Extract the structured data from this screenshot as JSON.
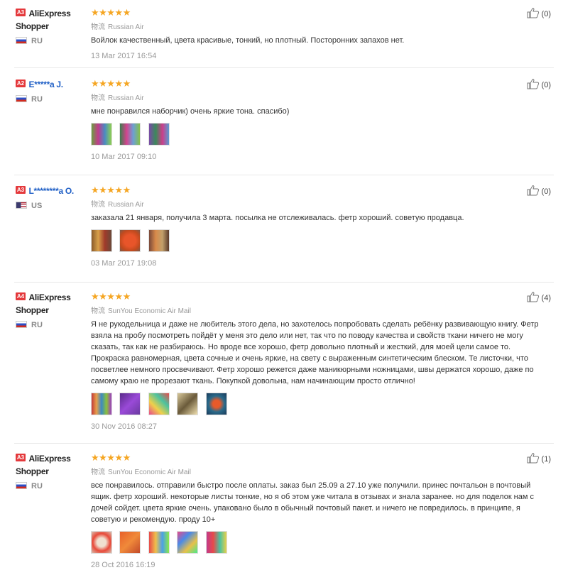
{
  "like_icon": "thumbs-up-icon",
  "reviews": [
    {
      "badge": "A3",
      "user": "AliExpress Shopper",
      "country": "RU",
      "rating": 5,
      "stars": "★★★★★",
      "shipping_cn": "物流",
      "shipping": "Russian Air",
      "text": "Войлок качественный, цвета красивые, тонкий, но плотный. Посторонних запахов нет.",
      "photo_count": 0,
      "date": "13 Mar 2017 16:54",
      "likes": "(0)"
    },
    {
      "badge": "A2",
      "user": "E*****a J.",
      "country": "RU",
      "rating": 5,
      "stars": "★★★★★",
      "shipping_cn": "物流",
      "shipping": "Russian Air",
      "text": "мне понравился наборчик) очень яркие тона. спасибо)",
      "photo_count": 3,
      "date": "10 Mar 2017 09:10",
      "likes": "(0)"
    },
    {
      "badge": "A3",
      "user": "L********a O.",
      "country": "US",
      "rating": 5,
      "stars": "★★★★★",
      "shipping_cn": "物流",
      "shipping": "Russian Air",
      "text": "заказала 21 января, получила 3 марта. посылка не отслеживалась. фетр хороший. советую продавца.",
      "photo_count": 3,
      "date": "03 Mar 2017 19:08",
      "likes": "(0)"
    },
    {
      "badge": "A4",
      "user": "AliExpress Shopper",
      "country": "RU",
      "rating": 5,
      "stars": "★★★★★",
      "shipping_cn": "物流",
      "shipping": "SunYou Economic Air Mail",
      "text": "Я не рукодельница и даже не любитель этого дела, но захотелось попробовать сделать ребёнку развивающую книгу. Фетр взяла на пробу посмотреть пойдёт у меня это дело или нет, так что по поводу качества и свойств ткани ничего не могу сказать, так как не разбираюсь. Но вроде все хорошо, фетр довольно плотный и жесткий, для моей цели самое то. Прокраска равномерная, цвета сочные и очень яркие, на свету с выраженным синтетическим блеском. Те листочки, что посветлее немного просвечивают. Фетр хорошо режется даже маникюрными ножницами, швы держатся хорошо, даже по самому краю не прорезают ткань. Покупкой довольна, нам начинающим просто отлично!",
      "photo_count": 5,
      "date": "30 Nov 2016 08:27",
      "likes": "(4)"
    },
    {
      "badge": "A3",
      "user": "AliExpress Shopper",
      "country": "RU",
      "rating": 5,
      "stars": "★★★★★",
      "shipping_cn": "物流",
      "shipping": "SunYou Economic Air Mail",
      "text": "все понравилось. отправили быстро после оплаты. заказ был 25.09 а 27.10 уже получили. принес почтальон в почтовый ящик. фетр хороший. некоторые листы тонкие, но я об этом уже читала в отзывах и знала заранее. но для поделок нам с дочей сойдет. цвета яркие очень. упаковано было в обычный почтовый пакет. и ничего не повредилось. в принципе, я советую и рекомендую. проду 10+",
      "photo_count": 5,
      "date": "28 Oct 2016 16:19",
      "likes": "(1)"
    }
  ]
}
